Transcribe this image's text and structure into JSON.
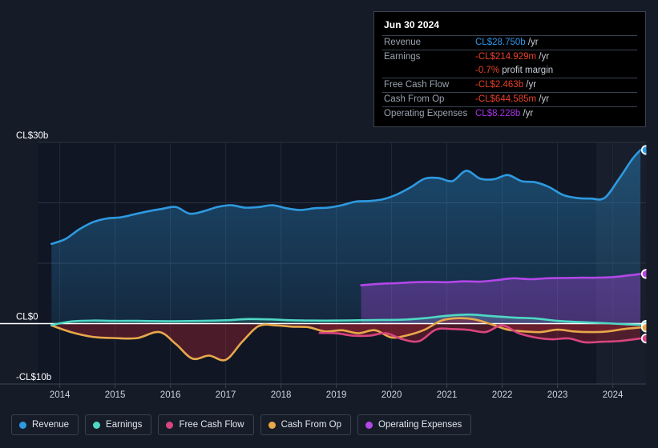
{
  "tooltip": {
    "date": "Jun 30 2024",
    "rows": [
      {
        "label": "Revenue",
        "value": "CL$28.750b",
        "unit": "/yr",
        "color_key": "rev"
      },
      {
        "label": "Earnings",
        "value": "-CL$214.929m",
        "unit": "/yr",
        "color_key": "neg"
      },
      {
        "label": "",
        "value": "-0.7%",
        "unit": "profit margin",
        "color_key": "neg",
        "continuation": true
      },
      {
        "label": "Free Cash Flow",
        "value": "-CL$2.463b",
        "unit": "/yr",
        "color_key": "neg"
      },
      {
        "label": "Cash From Op",
        "value": "-CL$644.585m",
        "unit": "/yr",
        "color_key": "neg"
      },
      {
        "label": "Operating Expenses",
        "value": "CL$8.228b",
        "unit": "/yr",
        "color_key": "opex"
      }
    ]
  },
  "legend": {
    "items": [
      {
        "label": "Revenue",
        "color": "#2e9ae0"
      },
      {
        "label": "Earnings",
        "color": "#4fd9c4"
      },
      {
        "label": "Free Cash Flow",
        "color": "#d9457f"
      },
      {
        "label": "Cash From Op",
        "color": "#e8a84a"
      },
      {
        "label": "Operating Expenses",
        "color": "#b347e8"
      }
    ]
  },
  "axis": {
    "y_labels": [
      "CL$30b",
      "CL$0",
      "-CL$10b"
    ],
    "x_labels": [
      "2014",
      "2015",
      "2016",
      "2017",
      "2018",
      "2019",
      "2020",
      "2021",
      "2022",
      "2023",
      "2024"
    ]
  },
  "chart_data": {
    "type": "area",
    "title": "",
    "xlabel": "",
    "ylabel": "CL$",
    "currency": "CL$",
    "units": "billions",
    "ylim": [
      -10,
      30
    ],
    "xlim": [
      2013.6,
      2024.6
    ],
    "gridlines": [
      30,
      20,
      10,
      0,
      -10
    ],
    "zero_line": 0,
    "grid": true,
    "legend_position": "bottom",
    "highlight_band": {
      "from": 2023.7,
      "to": 2024.6,
      "note": "recent/estimate shading"
    },
    "series": [
      {
        "name": "Revenue",
        "color": "#2e9ae0",
        "fill": true,
        "x": [
          2013.85,
          2014.1,
          2014.35,
          2014.6,
          2014.85,
          2015.1,
          2015.35,
          2015.6,
          2015.85,
          2016.1,
          2016.35,
          2016.6,
          2016.85,
          2017.1,
          2017.35,
          2017.6,
          2017.85,
          2018.1,
          2018.35,
          2018.6,
          2018.85,
          2019.1,
          2019.35,
          2019.6,
          2019.85,
          2020.1,
          2020.35,
          2020.6,
          2020.85,
          2021.1,
          2021.35,
          2021.6,
          2021.85,
          2022.1,
          2022.35,
          2022.6,
          2022.85,
          2023.1,
          2023.35,
          2023.6,
          2023.85,
          2024.1,
          2024.35,
          2024.5
        ],
        "values": [
          13.2,
          14.0,
          15.6,
          16.8,
          17.4,
          17.6,
          18.1,
          18.6,
          19.0,
          19.3,
          18.2,
          18.6,
          19.3,
          19.6,
          19.2,
          19.3,
          19.6,
          19.1,
          18.8,
          19.1,
          19.2,
          19.6,
          20.2,
          20.3,
          20.6,
          21.4,
          22.6,
          24.0,
          24.1,
          23.6,
          25.3,
          24.0,
          23.9,
          24.6,
          23.6,
          23.4,
          22.6,
          21.3,
          20.8,
          20.7,
          20.8,
          23.8,
          27.2,
          28.75
        ]
      },
      {
        "name": "Earnings",
        "color": "#4fd9c4",
        "fill": true,
        "x": [
          2013.85,
          2014.2,
          2014.6,
          2015.0,
          2015.4,
          2015.8,
          2016.2,
          2016.6,
          2017.0,
          2017.4,
          2017.8,
          2018.2,
          2018.6,
          2019.0,
          2019.4,
          2019.8,
          2020.2,
          2020.6,
          2021.0,
          2021.4,
          2021.8,
          2022.2,
          2022.6,
          2023.0,
          2023.4,
          2023.8,
          2024.2,
          2024.5
        ],
        "values": [
          -0.25,
          0.35,
          0.5,
          0.45,
          0.45,
          0.4,
          0.4,
          0.45,
          0.55,
          0.75,
          0.7,
          0.55,
          0.5,
          0.5,
          0.55,
          0.6,
          0.65,
          0.9,
          1.3,
          1.5,
          1.25,
          1.0,
          0.85,
          0.45,
          0.25,
          0.1,
          -0.1,
          -0.215
        ]
      },
      {
        "name": "Free Cash Flow",
        "color": "#d9457f",
        "fill": true,
        "x": [
          2018.7,
          2019.0,
          2019.3,
          2019.6,
          2019.9,
          2020.2,
          2020.5,
          2020.8,
          2021.1,
          2021.4,
          2021.7,
          2022.0,
          2022.3,
          2022.6,
          2022.9,
          2023.2,
          2023.5,
          2023.8,
          2024.1,
          2024.5
        ],
        "values": [
          -1.55,
          -1.6,
          -2.0,
          -2.0,
          -1.6,
          -2.6,
          -2.9,
          -1.0,
          -0.9,
          -1.05,
          -1.4,
          -0.3,
          -1.6,
          -2.3,
          -2.6,
          -2.45,
          -3.1,
          -3.0,
          -2.9,
          -2.463
        ]
      },
      {
        "name": "Cash From Op",
        "color": "#e8a84a",
        "fill": true,
        "x": [
          2013.85,
          2014.2,
          2014.6,
          2015.0,
          2015.4,
          2015.8,
          2016.1,
          2016.4,
          2016.7,
          2017.0,
          2017.3,
          2017.6,
          2017.9,
          2018.2,
          2018.5,
          2018.8,
          2019.1,
          2019.4,
          2019.7,
          2020.0,
          2020.3,
          2020.6,
          2020.9,
          2021.2,
          2021.5,
          2021.8,
          2022.1,
          2022.4,
          2022.7,
          2023.0,
          2023.3,
          2023.6,
          2023.9,
          2024.2,
          2024.5
        ],
        "values": [
          -0.3,
          -1.4,
          -2.2,
          -2.4,
          -2.4,
          -1.4,
          -3.4,
          -5.8,
          -5.3,
          -6.0,
          -3.0,
          -0.4,
          -0.3,
          -0.5,
          -0.6,
          -1.3,
          -1.1,
          -1.6,
          -1.1,
          -2.3,
          -1.9,
          -1.0,
          0.5,
          0.9,
          0.7,
          -0.1,
          -1.0,
          -1.3,
          -1.4,
          -1.0,
          -1.3,
          -1.4,
          -1.3,
          -0.9,
          -0.645
        ]
      },
      {
        "name": "Operating Expenses",
        "color": "#b347e8",
        "fill": true,
        "x": [
          2019.45,
          2019.8,
          2020.1,
          2020.4,
          2020.7,
          2021.0,
          2021.3,
          2021.6,
          2021.9,
          2022.2,
          2022.5,
          2022.8,
          2023.1,
          2023.4,
          2023.7,
          2024.0,
          2024.3,
          2024.5
        ],
        "values": [
          6.35,
          6.6,
          6.7,
          6.85,
          6.9,
          6.85,
          7.0,
          6.95,
          7.2,
          7.5,
          7.35,
          7.5,
          7.55,
          7.6,
          7.6,
          7.7,
          8.0,
          8.228
        ]
      }
    ],
    "end_markers": [
      {
        "series": "Revenue",
        "value": 28.75
      },
      {
        "series": "Operating Expenses",
        "value": 8.228
      },
      {
        "series": "Earnings",
        "value": -0.215
      },
      {
        "series": "Cash From Op",
        "value": -0.645
      },
      {
        "series": "Free Cash Flow",
        "value": -2.463
      }
    ]
  }
}
